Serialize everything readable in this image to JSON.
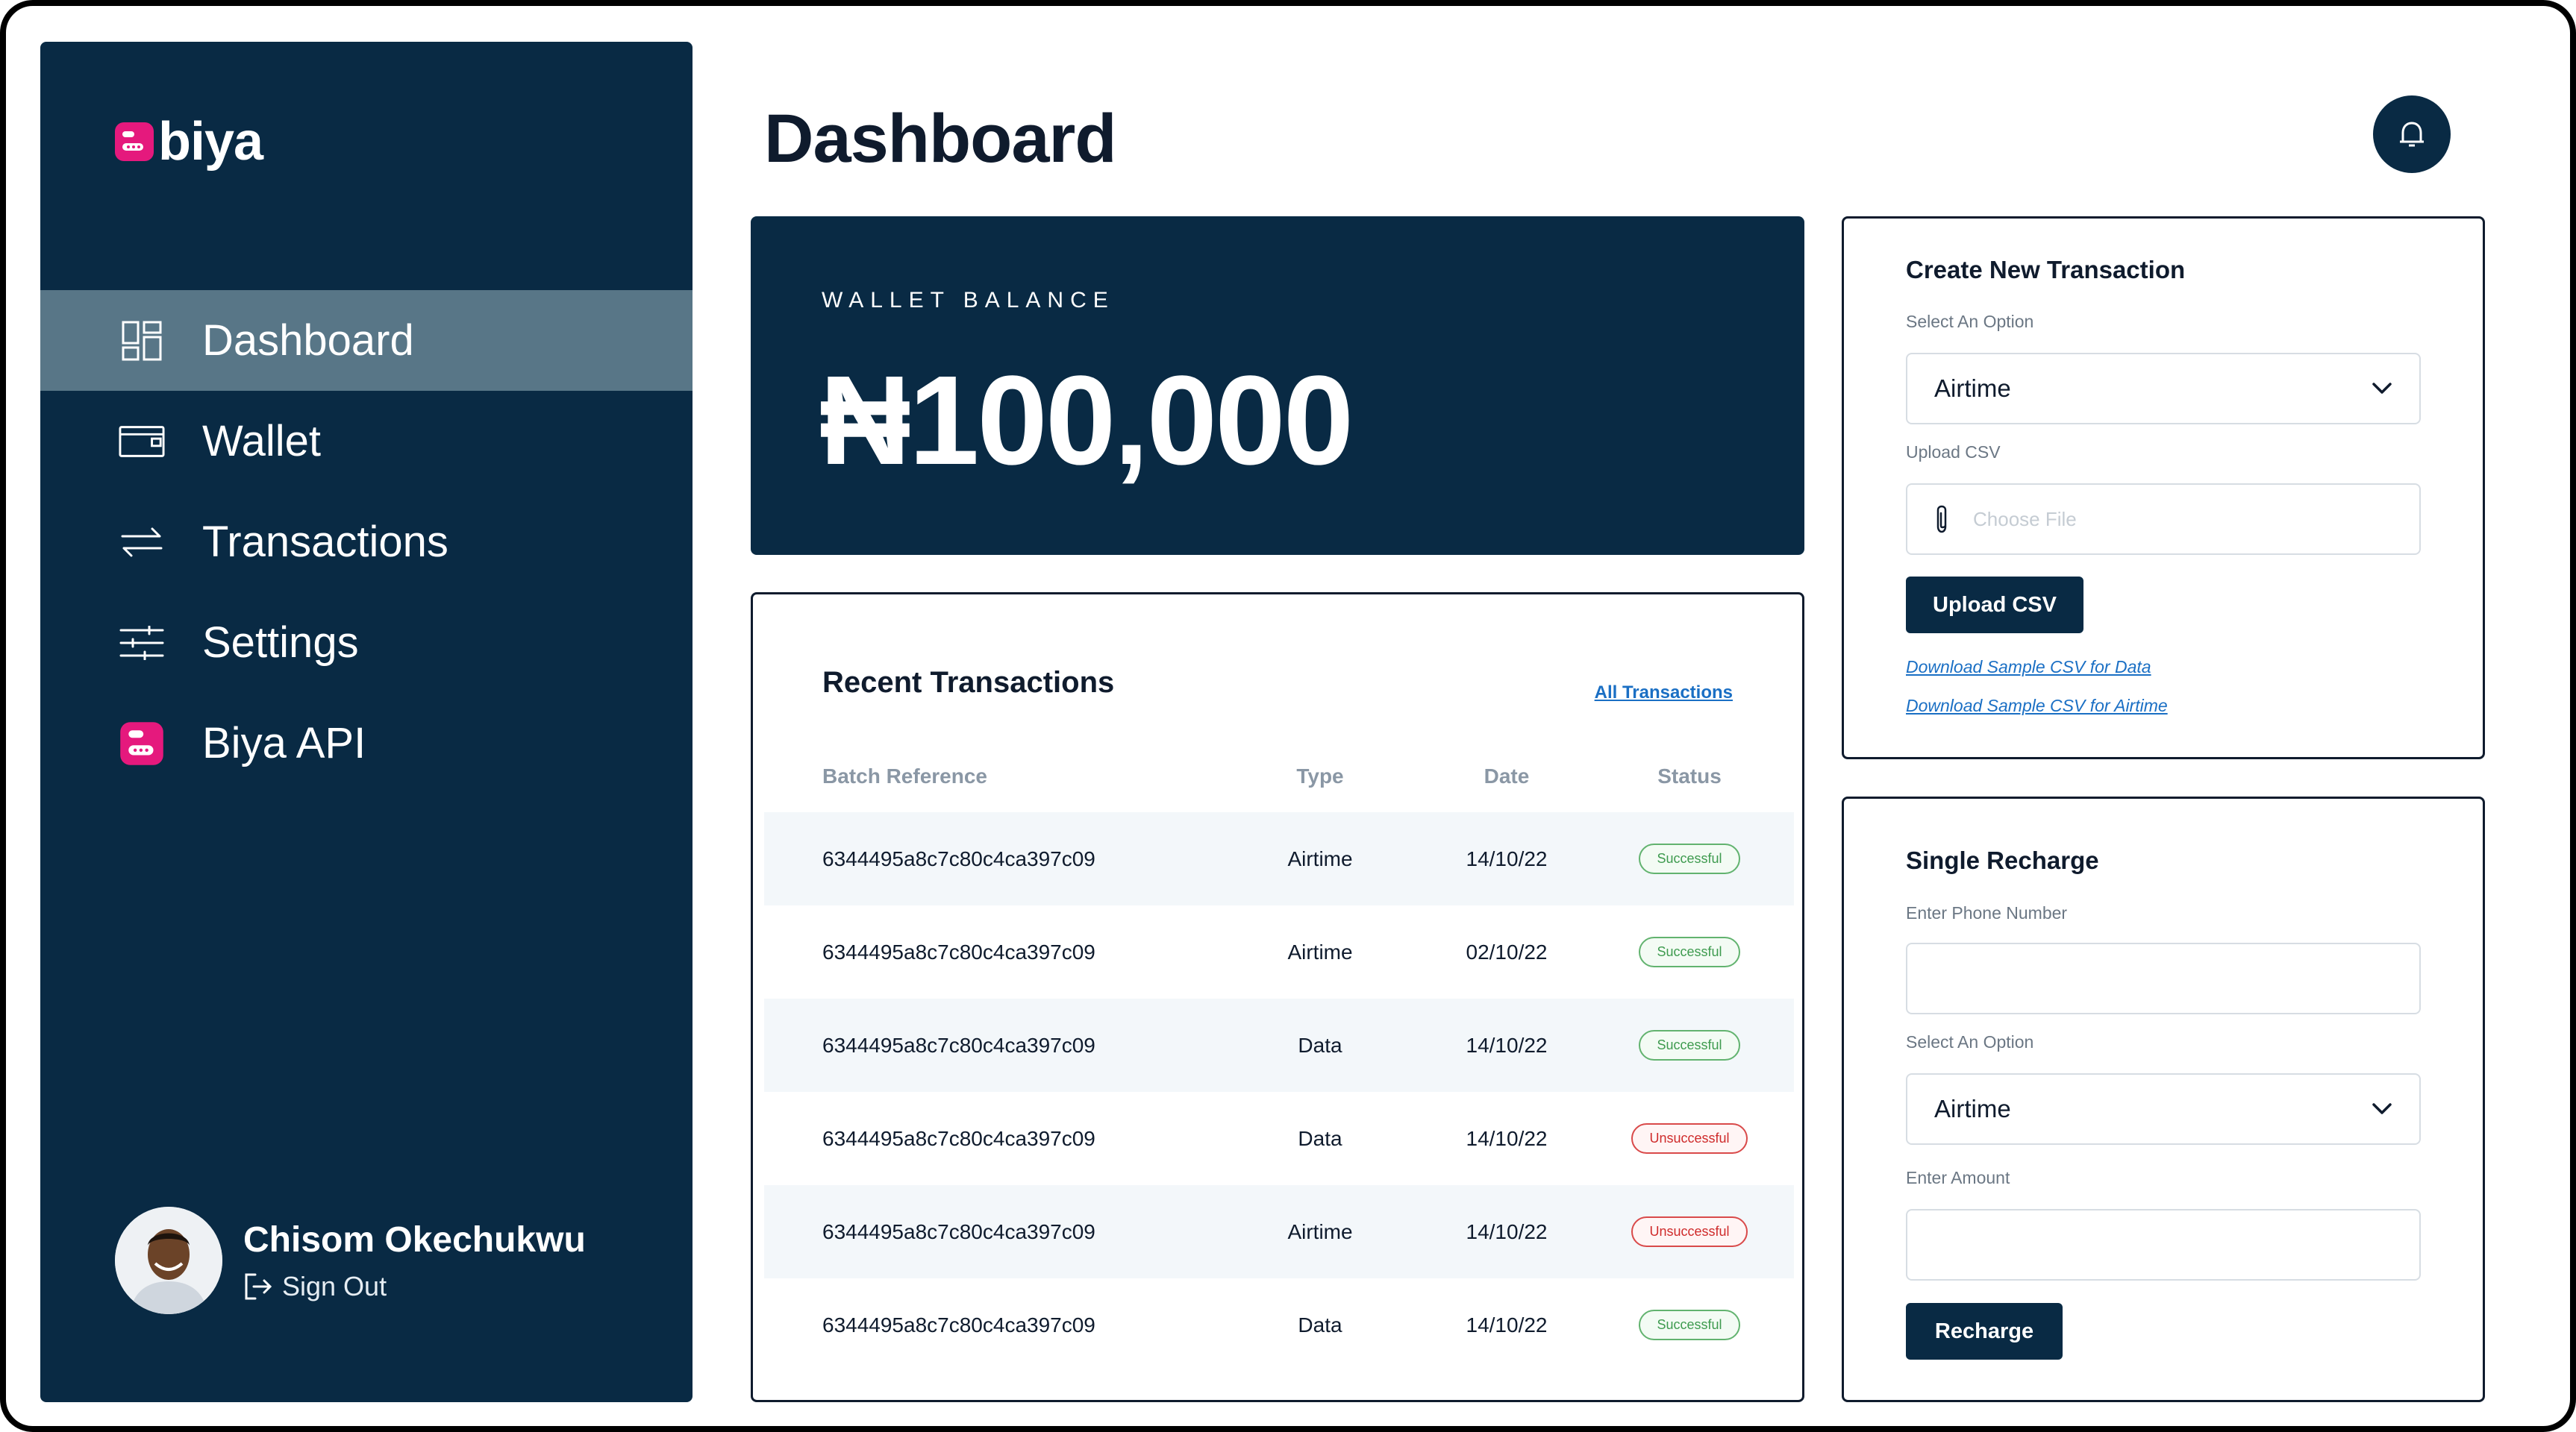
{
  "brand": {
    "name": "biya",
    "accent": "#e5197d",
    "navy": "#092a44"
  },
  "sidebar": {
    "items": [
      {
        "label": "Dashboard",
        "icon": "grid-icon",
        "active": true
      },
      {
        "label": "Wallet",
        "icon": "wallet-icon",
        "active": false
      },
      {
        "label": "Transactions",
        "icon": "arrows-swap-icon",
        "active": false
      },
      {
        "label": "Settings",
        "icon": "sliders-icon",
        "active": false
      },
      {
        "label": "Biya API",
        "icon": "biya-logo-icon",
        "active": false
      }
    ],
    "user": {
      "name": "Chisom Okechukwu",
      "signout_label": "Sign Out"
    }
  },
  "header": {
    "title": "Dashboard"
  },
  "wallet": {
    "label": "WALLET BALANCE",
    "amount": "₦100,000"
  },
  "recent": {
    "title": "Recent Transactions",
    "all_link": "All Transactions",
    "columns": [
      "Batch Reference",
      "Type",
      "Date",
      "Status"
    ],
    "rows": [
      {
        "ref": "6344495a8c7c80c4ca397c09",
        "type": "Airtime",
        "date": "14/10/22",
        "status": "Successful"
      },
      {
        "ref": "6344495a8c7c80c4ca397c09",
        "type": "Airtime",
        "date": "02/10/22",
        "status": "Successful"
      },
      {
        "ref": "6344495a8c7c80c4ca397c09",
        "type": "Data",
        "date": "14/10/22",
        "status": "Successful"
      },
      {
        "ref": "6344495a8c7c80c4ca397c09",
        "type": "Data",
        "date": "14/10/22",
        "status": "Unsuccessful"
      },
      {
        "ref": "6344495a8c7c80c4ca397c09",
        "type": "Airtime",
        "date": "14/10/22",
        "status": "Unsuccessful"
      },
      {
        "ref": "6344495a8c7c80c4ca397c09",
        "type": "Data",
        "date": "14/10/22",
        "status": "Successful"
      }
    ]
  },
  "create": {
    "title": "Create New Transaction",
    "option_label": "Select An Option",
    "option_value": "Airtime",
    "upload_label": "Upload CSV",
    "file_placeholder": "Choose File",
    "upload_button": "Upload CSV",
    "link_data": "Download Sample CSV for Data",
    "link_airtime": "Download Sample CSV for Airtime"
  },
  "single": {
    "title": "Single Recharge",
    "phone_label": "Enter Phone Number",
    "phone_value": "",
    "option_label": "Select An Option",
    "option_value": "Airtime",
    "amount_label": "Enter Amount",
    "amount_value": "",
    "button": "Recharge"
  }
}
